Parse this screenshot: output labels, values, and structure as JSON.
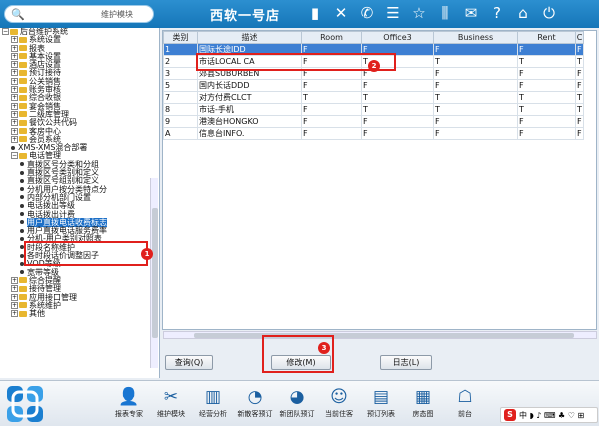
{
  "topbar": {
    "search_text": "维护模块",
    "hotel_name": "西软一号店",
    "icons": [
      "signal-icon",
      "tools-icon",
      "phone-icon",
      "list-icon",
      "star-icon",
      "columns-icon",
      "mail-icon",
      "help-icon",
      "home-icon",
      "power-icon"
    ]
  },
  "tree": {
    "items": [
      {
        "label": "后台维护系统",
        "level": 0,
        "kind": "root"
      },
      {
        "label": "系统设置",
        "level": 1,
        "kind": "folder"
      },
      {
        "label": "报表",
        "level": 1,
        "kind": "folder"
      },
      {
        "label": "基本设置",
        "level": 1,
        "kind": "folder"
      },
      {
        "label": "酒店设置",
        "level": 1,
        "kind": "folder"
      },
      {
        "label": "预订接待",
        "level": 1,
        "kind": "folder"
      },
      {
        "label": "公关销售",
        "level": 1,
        "kind": "folder"
      },
      {
        "label": "账务审核",
        "level": 1,
        "kind": "folder"
      },
      {
        "label": "综合收银",
        "level": 1,
        "kind": "folder"
      },
      {
        "label": "宴会销售",
        "level": 1,
        "kind": "folder"
      },
      {
        "label": "二级库管理",
        "level": 1,
        "kind": "folder"
      },
      {
        "label": "餐饮公共代码",
        "level": 1,
        "kind": "folder"
      },
      {
        "label": "客房中心",
        "level": 1,
        "kind": "folder"
      },
      {
        "label": "会员系统",
        "level": 1,
        "kind": "folder"
      },
      {
        "label": "XMS-XMS混合部署",
        "level": 1,
        "kind": "leaf"
      },
      {
        "label": "电话管理",
        "level": 1,
        "kind": "folder"
      },
      {
        "label": "直拨区号分类和分组",
        "level": 2,
        "kind": "leaf"
      },
      {
        "label": "直拨区号类别和定义",
        "level": 2,
        "kind": "leaf"
      },
      {
        "label": "直拨区号组别和定义",
        "level": 2,
        "kind": "leaf"
      },
      {
        "label": "分机用户按分类特点分",
        "level": 2,
        "kind": "leaf"
      },
      {
        "label": "内部分机部门设置",
        "level": 2,
        "kind": "leaf"
      },
      {
        "label": "电话拨出等级",
        "level": 2,
        "kind": "leaf"
      },
      {
        "label": "电话拨出计费",
        "level": 2,
        "kind": "leaf"
      },
      {
        "label": "用户直拨电话收费标志",
        "level": 2,
        "kind": "leaf",
        "selected": true
      },
      {
        "label": "用户直拨电话服务费率",
        "level": 2,
        "kind": "leaf"
      },
      {
        "label": "分机-用户类别对照表",
        "level": 2,
        "kind": "leaf"
      },
      {
        "label": "时段名称维护",
        "level": 2,
        "kind": "leaf"
      },
      {
        "label": "各时段话价调整因子",
        "level": 2,
        "kind": "leaf"
      },
      {
        "label": "VOD等级",
        "level": 2,
        "kind": "leaf"
      },
      {
        "label": "宽带等级",
        "level": 2,
        "kind": "leaf"
      },
      {
        "label": "综合提醒",
        "level": 1,
        "kind": "folder"
      },
      {
        "label": "接待管理",
        "level": 1,
        "kind": "folder"
      },
      {
        "label": "应用接口管理",
        "level": 1,
        "kind": "folder"
      },
      {
        "label": "系统维护",
        "level": 1,
        "kind": "folder"
      },
      {
        "label": "其他",
        "level": 1,
        "kind": "folder"
      }
    ]
  },
  "grid": {
    "columns": [
      "类别",
      "描述",
      "Room",
      "Office3",
      "Business",
      "Rent",
      "C"
    ],
    "rows": [
      {
        "cells": [
          "1",
          "国际长途IDD",
          "F",
          "F",
          "F",
          "F",
          "F"
        ],
        "selected": true
      },
      {
        "cells": [
          "2",
          "市话LOCAL CA",
          "F",
          "T",
          "T",
          "T",
          "T"
        ]
      },
      {
        "cells": [
          "3",
          "郊县SUBURBEN",
          "F",
          "F",
          "F",
          "F",
          "F"
        ]
      },
      {
        "cells": [
          "5",
          "国内长话DDD",
          "F",
          "F",
          "F",
          "F",
          "F"
        ]
      },
      {
        "cells": [
          "7",
          "对方付费CLCT",
          "T",
          "T",
          "T",
          "T",
          "T"
        ]
      },
      {
        "cells": [
          "8",
          "市话-手机",
          "F",
          "T",
          "T",
          "T",
          "T"
        ]
      },
      {
        "cells": [
          "9",
          "港澳台HONGKO",
          "F",
          "F",
          "F",
          "F",
          "F"
        ]
      },
      {
        "cells": [
          "A",
          "信息台INFO.",
          "F",
          "F",
          "F",
          "F",
          "F"
        ]
      }
    ]
  },
  "buttons": {
    "query": "查询(Q)",
    "modify": "修改(M)",
    "log": "日志(L)"
  },
  "badges": {
    "one": "1",
    "two": "2",
    "three": "3"
  },
  "dock": {
    "items": [
      {
        "label": "报表专家",
        "icon": "person-icon"
      },
      {
        "label": "维护模块",
        "icon": "tools-icon"
      },
      {
        "label": "经营分析",
        "icon": "bar-chart-icon"
      },
      {
        "label": "新散客预订",
        "icon": "reserve-icon"
      },
      {
        "label": "新团队预订",
        "icon": "group-reserve-icon"
      },
      {
        "label": "当前住客",
        "icon": "guest-icon"
      },
      {
        "label": "预订列表",
        "icon": "list-doc-icon"
      },
      {
        "label": "房态图",
        "icon": "room-map-icon"
      },
      {
        "label": "前台",
        "icon": "desk-icon"
      }
    ]
  },
  "tray": {
    "s_label": "S",
    "items": "中 ◗ ♪ ⌨ ♣ ♡ ⊞"
  },
  "colors": {
    "accent": "#1576b8",
    "highlight": "#e0201c",
    "selection": "#3d7fd3"
  }
}
